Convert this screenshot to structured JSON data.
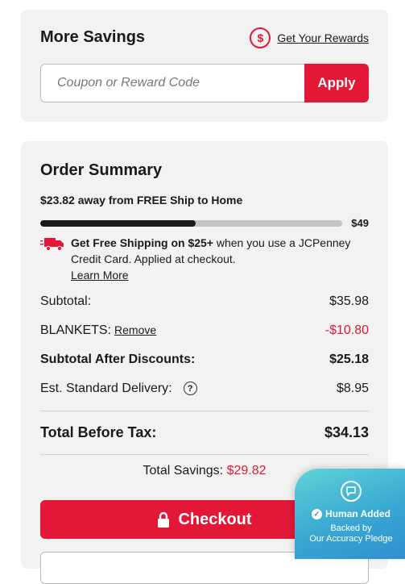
{
  "savings": {
    "title": "More Savings",
    "rewards_link": "Get Your Rewards",
    "rewards_icon": "$",
    "coupon_placeholder": "Coupon or Reward Code",
    "apply_label": "Apply"
  },
  "summary": {
    "title": "Order Summary",
    "free_ship_message": "$23.82 away from FREE Ship to Home",
    "free_ship_goal": "$49",
    "free_ship_progress_percent": 51.4,
    "promo_bold": "Get Free Shipping on $25+",
    "promo_rest": " when you use a JCPenney Credit Card. Applied at checkout.",
    "learn_more": "Learn More",
    "subtotal_label": "Subtotal:",
    "subtotal_value": "$35.98",
    "discount_label": "BLANKETS:",
    "discount_remove": "Remove",
    "discount_value": "-$10.80",
    "after_discounts_label": "Subtotal After Discounts:",
    "after_discounts_value": "$25.18",
    "delivery_label": "Est. Standard Delivery:",
    "delivery_help": "?",
    "delivery_value": "$8.95",
    "total_label": "Total Before Tax:",
    "total_value": "$34.13",
    "total_savings_label": "Total Savings:",
    "total_savings_value": "$29.82",
    "checkout_label": "Checkout"
  },
  "badge": {
    "title": "Human Added",
    "line1": "Backed by",
    "line2": "Our Accuracy Pledge"
  },
  "colors": {
    "accent": "#e31837",
    "card_bg": "#f2f2f2",
    "badge": "#3aa8d2"
  }
}
